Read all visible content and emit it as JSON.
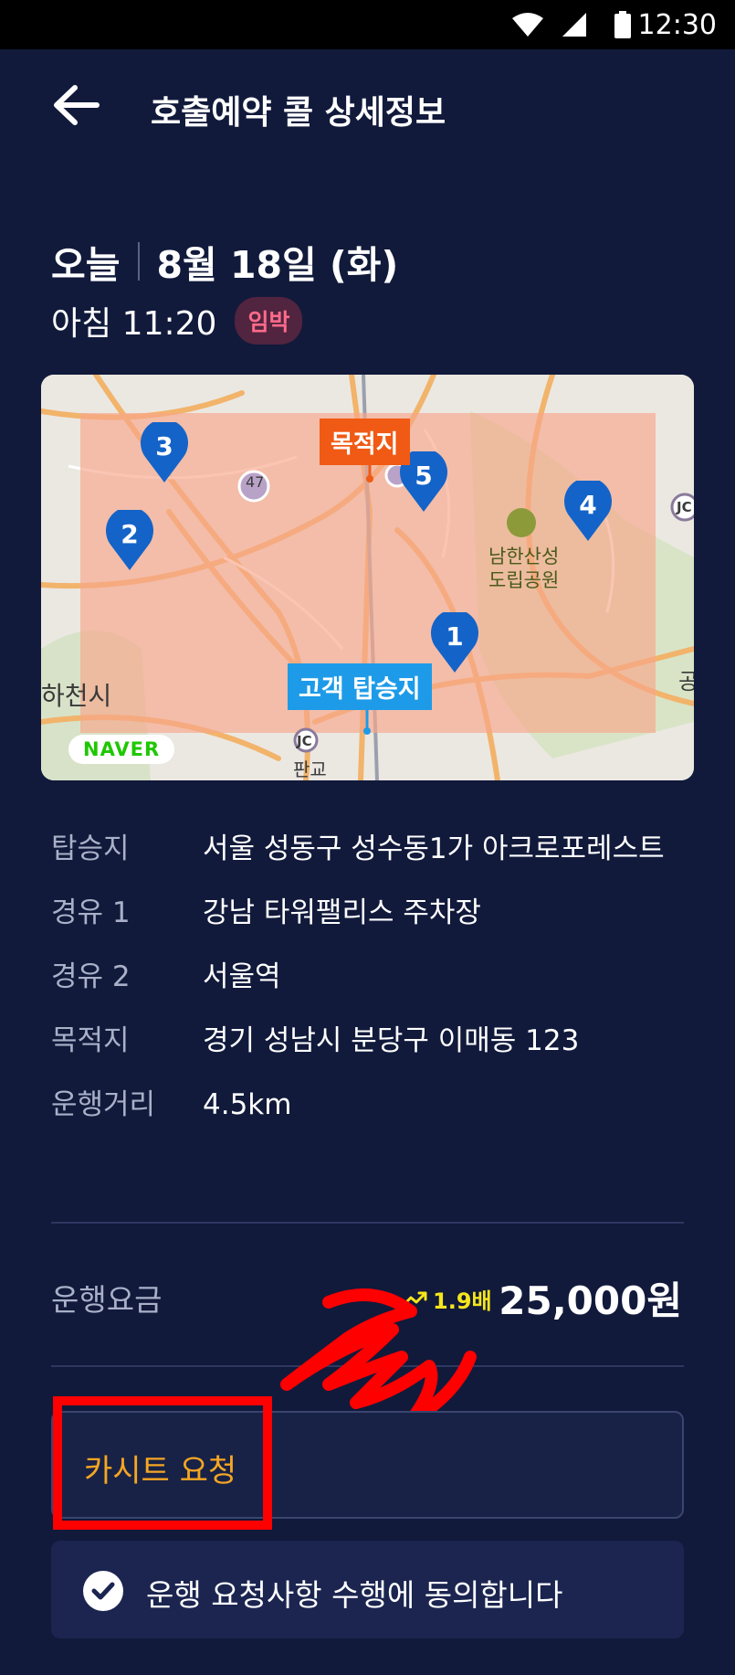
{
  "status_bar": {
    "time": "12:30"
  },
  "header": {
    "title": "호출예약 콜 상세정보"
  },
  "schedule": {
    "day": "오늘",
    "date": "8월 18일 (화)",
    "time": "아침 11:20",
    "badge": "임박"
  },
  "map": {
    "destination_label": "목적지",
    "pickup_label": "고객 탑승지",
    "pins": [
      "1",
      "2",
      "3",
      "4",
      "5"
    ],
    "park_label_line1": "남한산성",
    "park_label_line2": "도립공원",
    "city_label": "하천시",
    "jc_label": "JC",
    "road_number": "47",
    "pangyo_label": "판교",
    "edge_label": "공",
    "provider": "NAVER"
  },
  "trip": {
    "rows": [
      {
        "label": "탑승지",
        "value": "서울 성동구 성수동1가 아크로포레스트"
      },
      {
        "label": "경유 1",
        "value": "강남 타워팰리스 주차장"
      },
      {
        "label": "경유 2",
        "value": "서울역"
      },
      {
        "label": "목적지",
        "value": "경기 성남시 분당구 이매동 123"
      },
      {
        "label": "운행거리",
        "value": "4.5km"
      }
    ]
  },
  "fare": {
    "label": "운행요금",
    "multiplier": "1.9배",
    "amount": "25,000원"
  },
  "request": {
    "carseat_label": "카시트 요청"
  },
  "agreement": {
    "label": "운행 요청사항 수행에 동의합니다"
  },
  "colors": {
    "background": "#111a3b",
    "accent_orange": "#f5a623",
    "badge_text": "#ff6b8b",
    "multiplier": "#f6e51c",
    "pin_blue": "#1463c8",
    "destination_orange": "#f05a14",
    "pickup_blue": "#1d9be8"
  },
  "icons": [
    "wifi-icon",
    "signal-icon",
    "battery-icon",
    "back-arrow-icon",
    "surge-arrow-icon",
    "check-icon",
    "map-pin-icon",
    "park-icon"
  ]
}
